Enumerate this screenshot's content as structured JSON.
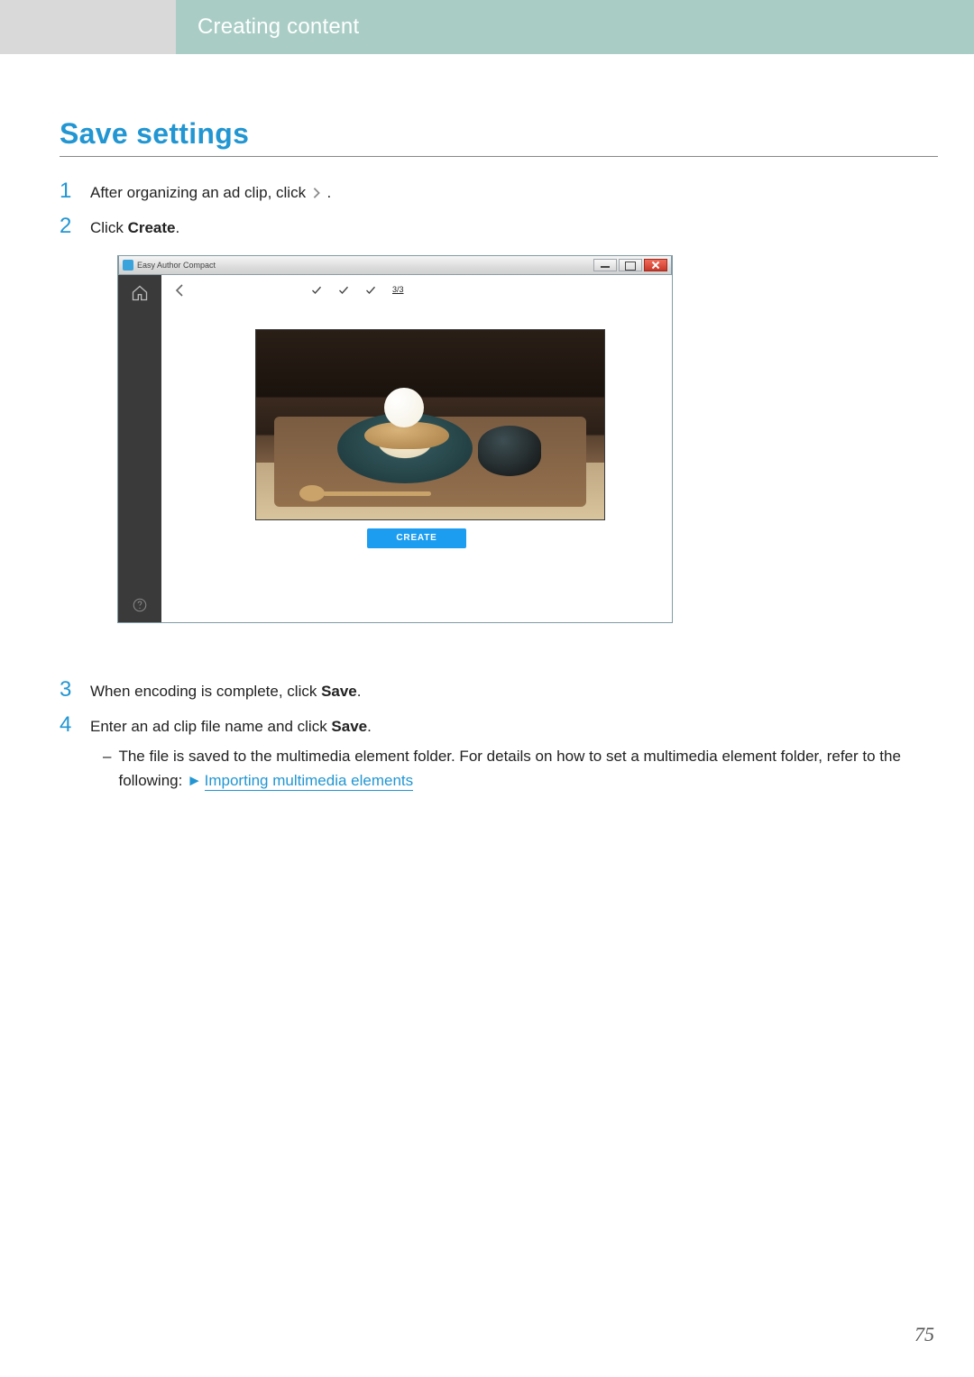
{
  "header": {
    "tab_label": "Creating content"
  },
  "heading": "Save settings",
  "steps": {
    "s1": {
      "num": "1",
      "text_before": "After organizing an ad clip, click ",
      "text_after": " ."
    },
    "s2": {
      "num": "2",
      "text_prefix": "Click ",
      "bold": "Create",
      "text_suffix": "."
    },
    "s3": {
      "num": "3",
      "text_prefix": "When encoding is complete, click ",
      "bold": "Save",
      "text_suffix": "."
    },
    "s4": {
      "num": "4",
      "text_prefix": "Enter an ad clip file name and click ",
      "bold": "Save",
      "text_suffix": ".",
      "bullet_prefix": "The file is saved to the multimedia element folder. For details on how to set a multimedia element folder, refer to the following:   ",
      "link_text": "Importing multimedia elements"
    }
  },
  "screenshot": {
    "title": "Easy Author Compact",
    "create_label": "CREATE",
    "ratio_label": "3/3"
  },
  "page_number": "75"
}
